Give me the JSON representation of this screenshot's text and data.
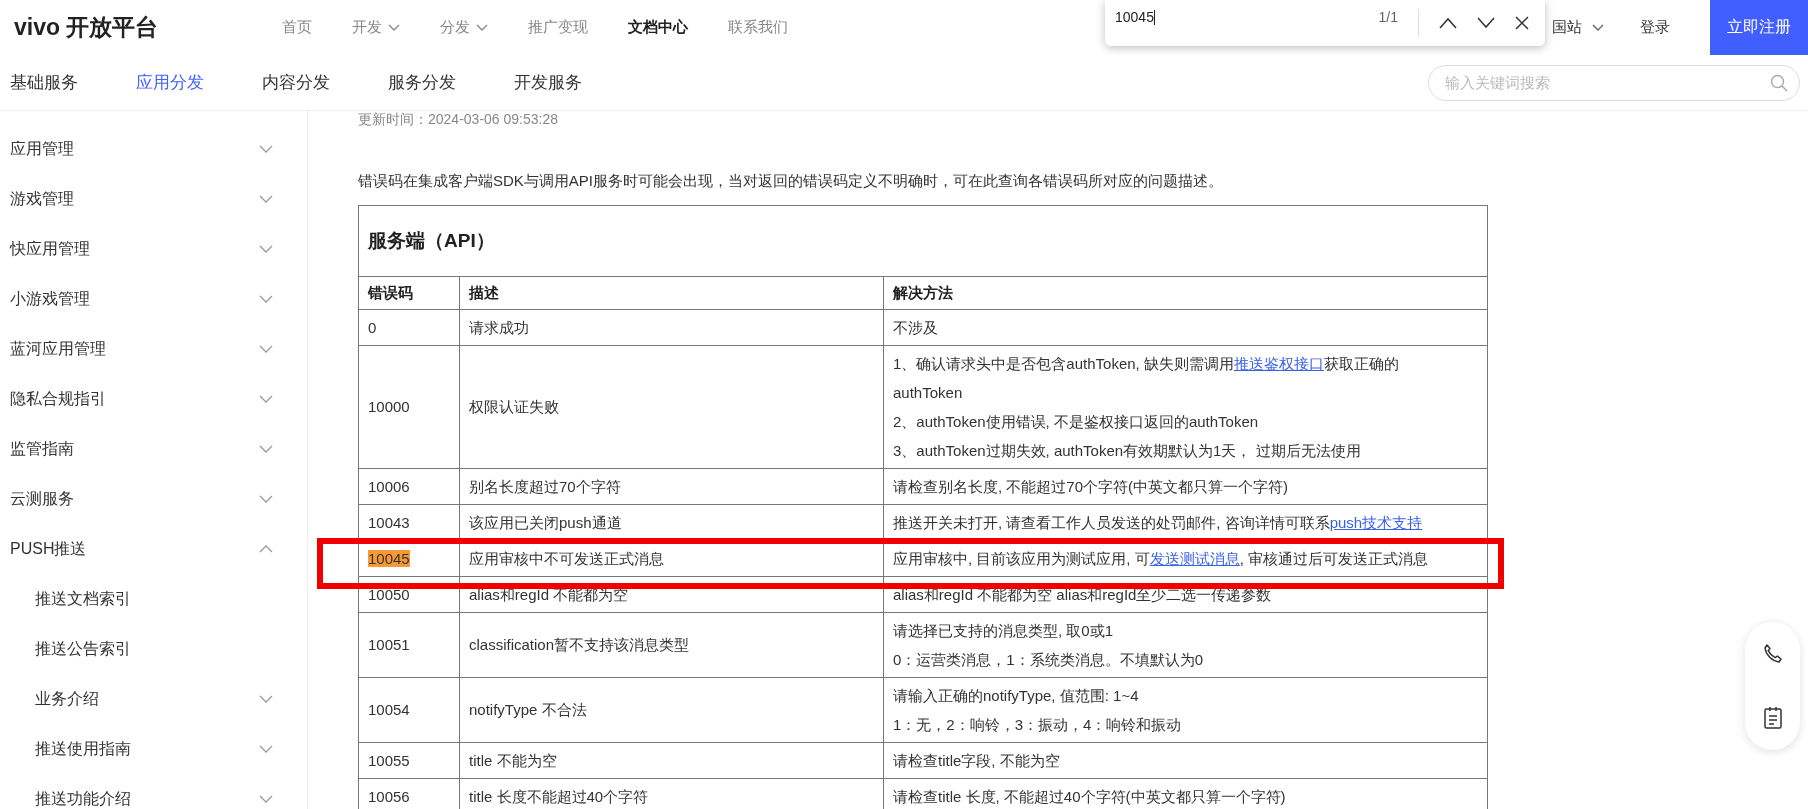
{
  "header": {
    "logo": "vivo 开放平台",
    "nav": [
      {
        "label": "首页",
        "selected": false,
        "dropdown": false
      },
      {
        "label": "开发",
        "selected": false,
        "dropdown": true
      },
      {
        "label": "分发",
        "selected": false,
        "dropdown": true
      },
      {
        "label": "推广变现",
        "selected": false,
        "dropdown": false
      },
      {
        "label": "文档中心",
        "selected": true,
        "dropdown": false
      },
      {
        "label": "联系我们",
        "selected": false,
        "dropdown": false
      }
    ],
    "region": "国站",
    "login": "登录",
    "register": "立即注册"
  },
  "find_bar": {
    "value": "10045",
    "count": "1/1"
  },
  "subnav": {
    "tabs": [
      {
        "label": "基础服务",
        "selected": false
      },
      {
        "label": "应用分发",
        "selected": true
      },
      {
        "label": "内容分发",
        "selected": false
      },
      {
        "label": "服务分发",
        "selected": false
      },
      {
        "label": "开发服务",
        "selected": false
      }
    ],
    "search": {
      "placeholder": "输入关键词搜索"
    }
  },
  "sidebar": {
    "items": [
      {
        "label": "应用管理",
        "expanded": false
      },
      {
        "label": "游戏管理",
        "expanded": false
      },
      {
        "label": "快应用管理",
        "expanded": false
      },
      {
        "label": "小游戏管理",
        "expanded": false
      },
      {
        "label": "蓝河应用管理",
        "expanded": false
      },
      {
        "label": "隐私合规指引",
        "expanded": false
      },
      {
        "label": "监管指南",
        "expanded": false
      },
      {
        "label": "云测服务",
        "expanded": false
      },
      {
        "label": "PUSH推送",
        "expanded": true,
        "children": [
          {
            "label": "推送文档索引"
          },
          {
            "label": "推送公告索引"
          },
          {
            "label": "业务介绍",
            "expanded": false
          },
          {
            "label": "推送使用指南",
            "expanded": false
          },
          {
            "label": "推送功能介绍",
            "expanded": false
          }
        ]
      }
    ]
  },
  "article": {
    "updated": "更新时间：2024-03-06 09:53:28",
    "intro": "错误码在集成客户端SDK与调用API服务时可能会出现，当对返回的错误码定义不明确时，可在此查询各错误码所对应的问题描述。",
    "table": {
      "title": "服务端（API）",
      "columns": [
        "错误码",
        "描述",
        "解决方法"
      ],
      "rows": [
        {
          "code": "0",
          "desc": "请求成功",
          "match": false,
          "annotated": false,
          "solution": [
            [
              {
                "kind": "text",
                "text": "不涉及"
              }
            ]
          ]
        },
        {
          "code": "10000",
          "desc": "权限认证失败",
          "match": false,
          "annotated": false,
          "solution": [
            [
              {
                "kind": "text",
                "text": "1、确认请求头中是否包含authToken, 缺失则需调用"
              },
              {
                "kind": "link",
                "text": "推送鉴权接口"
              },
              {
                "kind": "text",
                "text": "获取正确的"
              }
            ],
            [
              {
                "kind": "text",
                "text": "authToken"
              }
            ],
            [
              {
                "kind": "text",
                "text": "2、authToken使用错误, 不是鉴权接口返回的authToken"
              }
            ],
            [
              {
                "kind": "text",
                "text": "3、authToken过期失效, authToken有效期默认为1天， 过期后无法使用"
              }
            ]
          ]
        },
        {
          "code": "10006",
          "desc": "别名长度超过70个字符",
          "match": false,
          "annotated": false,
          "solution": [
            [
              {
                "kind": "text",
                "text": "请检查别名长度, 不能超过70个字符(中英文都只算一个字符)"
              }
            ]
          ]
        },
        {
          "code": "10043",
          "desc": "该应用已关闭push通道",
          "match": false,
          "annotated": false,
          "solution": [
            [
              {
                "kind": "text",
                "text": "推送开关未打开, 请查看工作人员发送的处罚邮件, 咨询详情可联系"
              },
              {
                "kind": "link",
                "text": "push技术支持"
              }
            ]
          ]
        },
        {
          "code": "10045",
          "desc": "应用审核中不可发送正式消息",
          "match": true,
          "annotated": true,
          "solution": [
            [
              {
                "kind": "text",
                "text": "应用审核中, 目前该应用为测试应用, 可"
              },
              {
                "kind": "link",
                "text": "发送测试消息"
              },
              {
                "kind": "text",
                "text": ", 审核通过后可发送正式消息"
              }
            ]
          ]
        },
        {
          "code": "10050",
          "desc": "alias和regId 不能都为空",
          "match": false,
          "annotated": false,
          "solution": [
            [
              {
                "kind": "text",
                "text": "alias和regId 不能都为空 alias和regId至少二选一传递参数"
              }
            ]
          ]
        },
        {
          "code": "10051",
          "desc": "classification暂不支持该消息类型",
          "match": false,
          "annotated": false,
          "solution": [
            [
              {
                "kind": "text",
                "text": "请选择已支持的消息类型, 取0或1"
              }
            ],
            [
              {
                "kind": "text",
                "text": "0：运营类消息，1：系统类消息。不填默认为0"
              }
            ]
          ]
        },
        {
          "code": "10054",
          "desc": "notifyType 不合法",
          "match": false,
          "annotated": false,
          "solution": [
            [
              {
                "kind": "text",
                "text": "请输入正确的notifyType, 值范围: 1~4"
              }
            ],
            [
              {
                "kind": "text",
                "text": "1：无，2：响铃，3：振动，4：响铃和振动"
              }
            ]
          ]
        },
        {
          "code": "10055",
          "desc": "title 不能为空",
          "match": false,
          "annotated": false,
          "solution": [
            [
              {
                "kind": "text",
                "text": "请检查title字段, 不能为空"
              }
            ]
          ]
        },
        {
          "code": "10056",
          "desc": "title 长度不能超过40个字符",
          "match": false,
          "annotated": false,
          "solution": [
            [
              {
                "kind": "text",
                "text": "请检查title 长度, 不能超过40个字符(中英文都只算一个字符)"
              }
            ]
          ]
        }
      ]
    }
  }
}
